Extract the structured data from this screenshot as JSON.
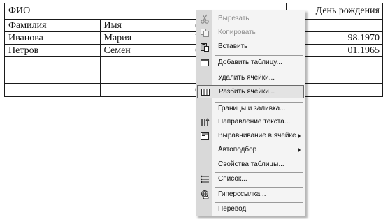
{
  "document": {
    "header": {
      "fio": "ФИО",
      "birthday": "День рождения"
    },
    "columns": [
      "Фамилия",
      "Имя",
      "",
      "",
      ""
    ],
    "rows": [
      {
        "last": "Иванова",
        "first": "Мария",
        "c3": "",
        "date": "98.1970"
      },
      {
        "last": "Петров",
        "first": "Семен",
        "c3": "",
        "date": "01.1965"
      }
    ],
    "partial_glyphs": [
      "Р",
      "(",
      "С",
      "("
    ]
  },
  "context_menu": {
    "items": [
      {
        "label": "Вырезать",
        "icon": "scissors-icon",
        "disabled": true
      },
      {
        "label": "Копировать",
        "icon": "copy-icon",
        "disabled": true
      },
      {
        "label": "Вставить",
        "icon": "paste-icon"
      },
      {
        "label": "Добавить таблицу...",
        "icon": "insert-table-icon"
      },
      {
        "label": "Удалить ячейки...",
        "icon": ""
      },
      {
        "label": "Разбить ячейки...",
        "icon": "split-cells-icon",
        "highlighted": true
      },
      {
        "label": "Границы и заливка...",
        "icon": ""
      },
      {
        "label": "Направление текста...",
        "icon": "text-direction-icon"
      },
      {
        "label": "Выравнивание в ячейке",
        "icon": "cell-alignment-icon",
        "submenu": true
      },
      {
        "label": "Автоподбор",
        "icon": "",
        "submenu": true
      },
      {
        "label": "Свойства таблицы...",
        "icon": ""
      },
      {
        "label": "Список...",
        "icon": "bullet-list-icon"
      },
      {
        "label": "Гиперссылка...",
        "icon": "hyperlink-icon"
      },
      {
        "label": "Перевод",
        "icon": ""
      }
    ]
  },
  "colors": {
    "menu_bg": "#f4f4f4",
    "gutter": "#d9d9d9",
    "highlight": "#e3e3e3",
    "disabled_text": "#8c8c8c"
  }
}
